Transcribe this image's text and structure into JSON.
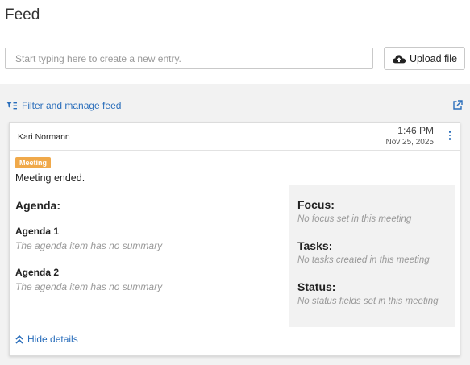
{
  "page": {
    "title": "Feed"
  },
  "entry": {
    "placeholder": "Start typing here to create a new entry."
  },
  "upload": {
    "label": "Upload file",
    "icon": "cloud-upload-icon"
  },
  "filter": {
    "label": "Filter and manage feed",
    "icon": "filter-icon"
  },
  "external": {
    "icon": "external-link-icon"
  },
  "card": {
    "author": "Kari Normann",
    "time": "1:46 PM",
    "date": "Nov 25, 2025",
    "badge": "Meeting",
    "status": "Meeting ended.",
    "agenda_heading": "Agenda:",
    "agenda": [
      {
        "title": "Agenda 1",
        "summary": "The agenda item has no summary"
      },
      {
        "title": "Agenda 2",
        "summary": "The agenda item has no summary"
      }
    ],
    "focus": {
      "title": "Focus:",
      "text": "No focus set in this meeting"
    },
    "tasks": {
      "title": "Tasks:",
      "text": "No tasks created in this meeting"
    },
    "status_fields": {
      "title": "Status:",
      "text": "No status fields set in this meeting"
    },
    "hide_details": "Hide details"
  },
  "colors": {
    "accent": "#2a6ebb",
    "badge": "#f0a94a",
    "panel": "#f2f2f2"
  }
}
